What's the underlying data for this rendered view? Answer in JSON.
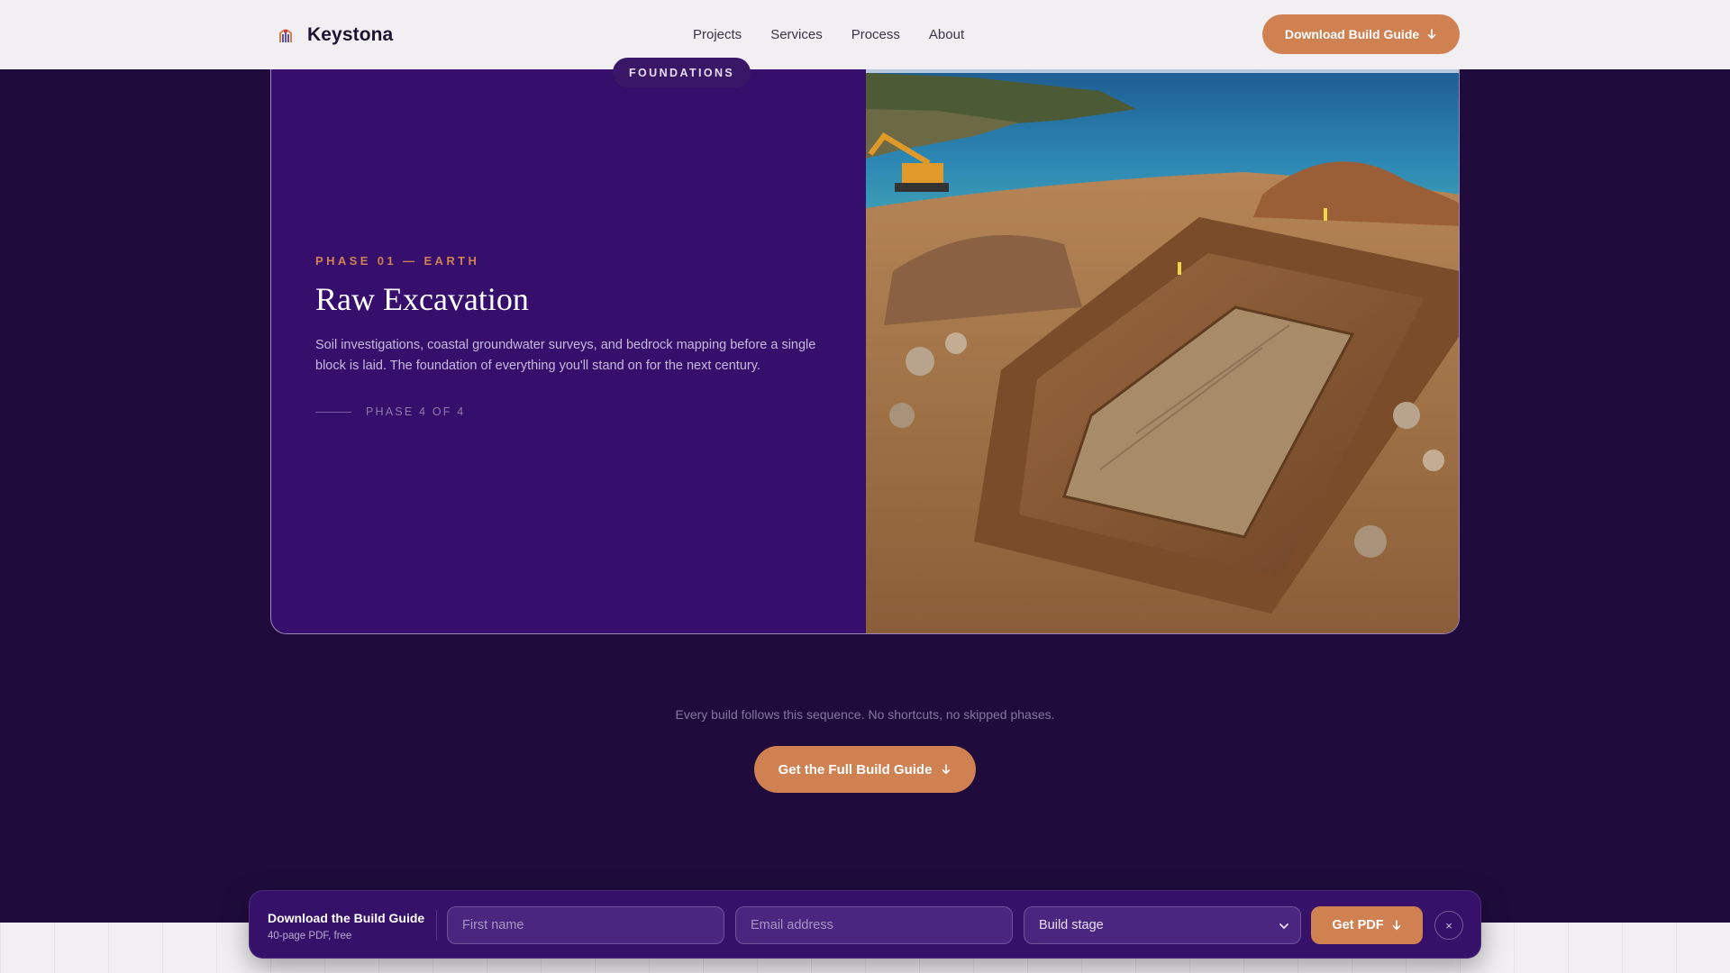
{
  "brand": {
    "name": "Keystona",
    "logo_icon": "keystone-logo-icon"
  },
  "nav": {
    "links": [
      "Projects",
      "Services",
      "Process",
      "About"
    ],
    "cta_label": "Download Build Guide"
  },
  "phase": {
    "eyebrow": "PHASE 01 — EARTH",
    "title": "Raw Excavation",
    "description": "Soil investigations, coastal groundwater surveys, and bedrock mapping before a single block is laid. The foundation of everything you'll stand on for the next century.",
    "counter": "PHASE 4 OF 4",
    "image_badge": "FOUNDATIONS"
  },
  "sequence": {
    "note": "Every build follows this sequence. No shortcuts, no skipped phases.",
    "cta_label": "Get the Full Build Guide"
  },
  "lead_form": {
    "title": "Download the Build Guide",
    "subtitle": "40-page PDF, free",
    "first_name_placeholder": "First name",
    "email_placeholder": "Email address",
    "stage_selected": "Build stage",
    "submit_label": "Get PDF",
    "close_label": "×"
  },
  "colors": {
    "accent": "#d08152",
    "page_bg": "#1f0c3d",
    "card_bg": "#360f6c",
    "header_bg": "#f2eff2"
  }
}
